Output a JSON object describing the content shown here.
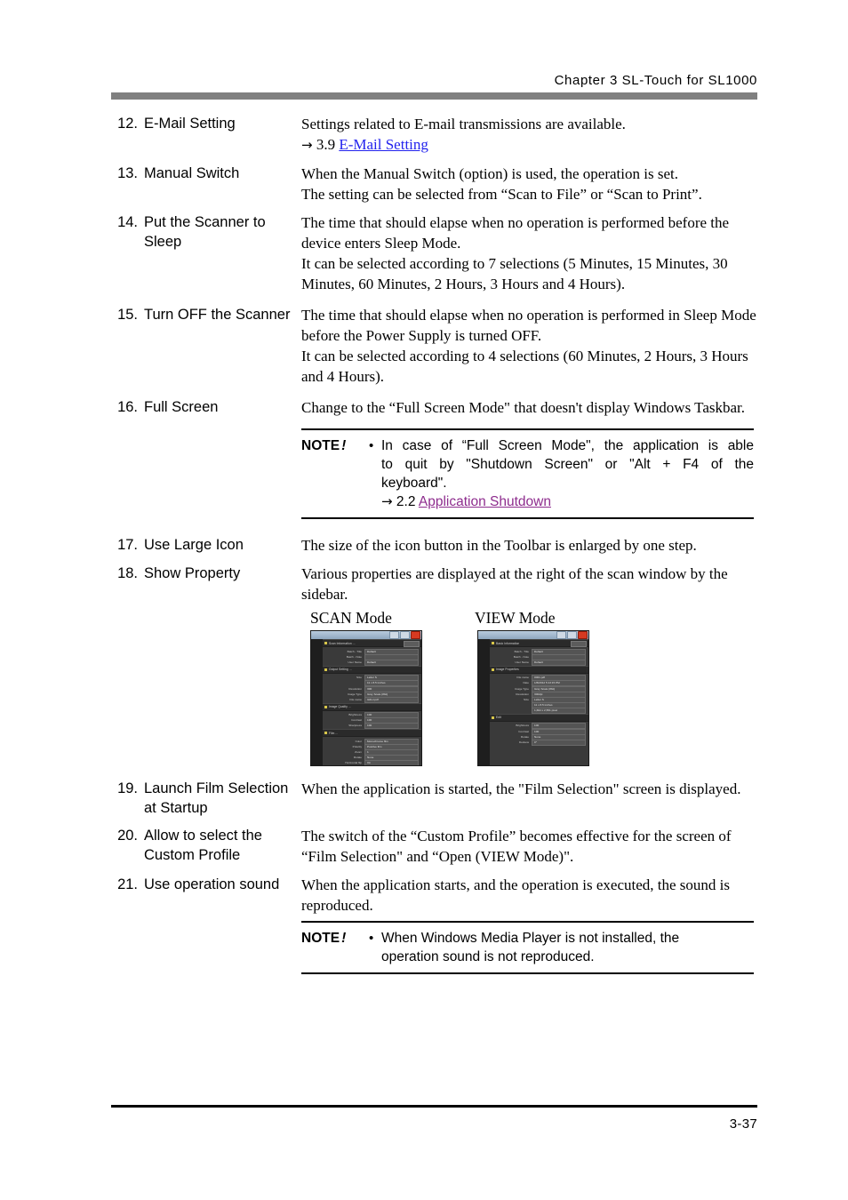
{
  "header": {
    "chapter_title": "Chapter 3 SL-Touch for SL1000"
  },
  "footer": {
    "page_number": "3-37"
  },
  "entries": [
    {
      "num": "12.",
      "term": "E-Mail Setting",
      "lines": [
        "Settings related to E-mail transmissions are available."
      ],
      "link_ref": {
        "arrow": "→",
        "section": "3.9",
        "label": "E-Mail Setting",
        "state": "unvisited"
      }
    },
    {
      "num": "13.",
      "term": "Manual Switch",
      "lines": [
        "When the Manual Switch (option) is used, the operation is set.",
        "The setting can be selected from “Scan to File” or “Scan to Print”."
      ]
    },
    {
      "num": "14.",
      "term": "Put the Scanner to Sleep",
      "lines": [
        "The time that should elapse when no operation is performed before the device enters Sleep Mode.",
        "It can be selected according to 7 selections (5 Minutes, 15 Minutes, 30 Minutes, 60 Minutes, 2 Hours, 3 Hours and 4 Hours)."
      ]
    },
    {
      "num": "15.",
      "term": "Turn OFF the Scanner",
      "lines": [
        "The time that should elapse when no operation is performed in Sleep Mode before the Power Supply is turned OFF.",
        "It can be selected according to 4 selections (60 Minutes, 2 Hours, 3 Hours and 4 Hours)."
      ]
    },
    {
      "num": "16.",
      "term": "Full Screen",
      "lines": [
        "Change to the “Full Screen Mode\" that doesn't display Windows Taskbar."
      ]
    },
    {
      "num": "17.",
      "term": "Use Large Icon",
      "lines": [
        "The size of the icon button in the Toolbar is enlarged by one step."
      ]
    },
    {
      "num": "18.",
      "term": "Show Property",
      "lines": [
        "Various properties are displayed at the right of the scan window by the sidebar."
      ]
    },
    {
      "num": "19.",
      "term": "Launch Film Selection at Startup",
      "lines": [
        "When the application is started, the \"Film Selection\" screen is displayed."
      ]
    },
    {
      "num": "20.",
      "term": "Allow to select the Custom Profile",
      "lines": [
        "The switch of the “Custom Profile” becomes effective for the screen of  “Film Selection\" and “Open (VIEW Mode)\"."
      ]
    },
    {
      "num": "21.",
      "term": "Use operation sound",
      "lines": [
        "When the application starts, and the operation is executed, the sound is reproduced."
      ]
    }
  ],
  "notes": [
    {
      "label": "NOTE",
      "bang": "!",
      "bullet": "•",
      "line1": "In case of “Full Screen Mode\", the application is able",
      "line2": "to quit by \"Shutdown Screen\" or \"Alt + F4 of the",
      "line3": "keyboard\".",
      "link_ref": {
        "arrow": "→",
        "section": "2.2",
        "label": "Application Shutdown",
        "state": "visited"
      }
    },
    {
      "label": "NOTE",
      "bang": "!",
      "bullet": "•",
      "line1": "When Windows Media Player is not installed, the",
      "line2": "operation sound is not reproduced."
    }
  ],
  "figure": {
    "caption_scan": "SCAN Mode",
    "caption_view": "VIEW Mode",
    "scan_window": {
      "groups": [
        {
          "title": "Scan Information ...",
          "has_button": true,
          "rows": [
            {
              "label": "Batch - Title",
              "value": "Default"
            },
            {
              "label": "Batch - Note",
              "value": ""
            },
            {
              "label": "User Name",
              "value": "Default"
            }
          ]
        },
        {
          "title": "Output Setting ...",
          "has_button": false,
          "rows": [
            {
              "label": "Size",
              "value": "Letter S"
            },
            {
              "label": "",
              "value": "11 x 8.5 inches"
            },
            {
              "label": "Resolution",
              "value": "300"
            },
            {
              "label": "Image Type",
              "value": "Gray Scale (8bit)"
            },
            {
              "label": "File name",
              "value": "G0LJ.pdf"
            }
          ]
        },
        {
          "title": "Image Quality ...",
          "has_button": false,
          "rows": [
            {
              "label": "Brightness",
              "value": "100"
            },
            {
              "label": "Contrast",
              "value": "100"
            },
            {
              "label": "Sharpness",
              "value": "100"
            }
          ]
        },
        {
          "title": "Film ...",
          "has_button": false,
          "rows": [
            {
              "label": "Color",
              "value": "Monochrome film"
            },
            {
              "label": "Polarity",
              "value": "Positive film"
            },
            {
              "label": "Zoom",
              "value": "1"
            },
            {
              "label": "Rotate",
              "value": "None"
            },
            {
              "label": "Horizontal flip",
              "value": "On"
            },
            {
              "label": "Deskew",
              "value": "0°"
            }
          ]
        }
      ]
    },
    "view_window": {
      "groups": [
        {
          "title": "Basic Information",
          "has_button": true,
          "rows": [
            {
              "label": "Batch - Title",
              "value": "Default"
            },
            {
              "label": "Batch - Note",
              "value": ""
            },
            {
              "label": "User Name",
              "value": "Default"
            }
          ]
        },
        {
          "title": "Image Properties",
          "has_button": false,
          "rows": [
            {
              "label": "File name",
              "value": "0001.pdf"
            },
            {
              "label": "Date",
              "value": "1/6/2012 5:13:15 PM"
            },
            {
              "label": "Image Type",
              "value": "Gray Scale (8bit)"
            },
            {
              "label": "Resolution",
              "value": "300dpi"
            },
            {
              "label": "Size",
              "value": "Letter S"
            },
            {
              "label": "",
              "value": "11 x 8.5 inches"
            },
            {
              "label": "",
              "value": "1,694 x 2,551 pixel"
            }
          ]
        },
        {
          "title": "Edit",
          "has_button": false,
          "rows": [
            {
              "label": "Brightness",
              "value": "100"
            },
            {
              "label": "Contrast",
              "value": "100"
            },
            {
              "label": "Rotate",
              "value": "None"
            },
            {
              "label": "Deskew",
              "value": "0°"
            }
          ]
        }
      ]
    }
  }
}
